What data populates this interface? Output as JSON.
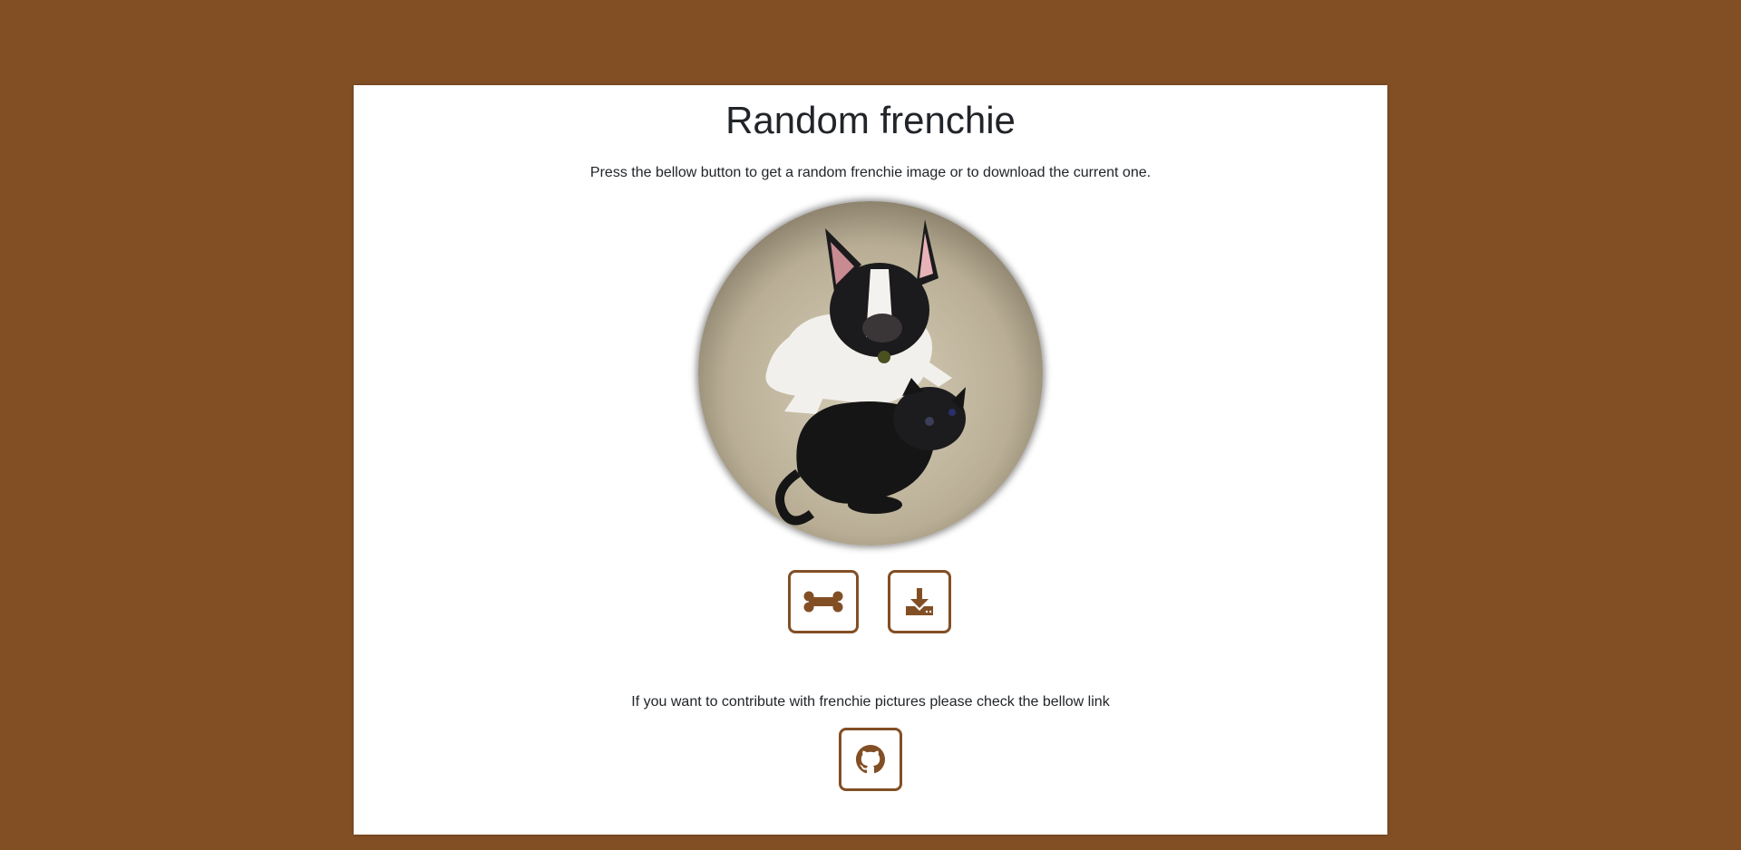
{
  "page": {
    "title": "Random frenchie",
    "subtitle": "Press the bellow button to get a random frenchie image or to download the current one.",
    "contribute_text": "If you want to contribute with frenchie pictures please check the bellow link"
  },
  "buttons": {
    "random_icon": "bone-icon",
    "download_icon": "download-icon",
    "github_icon": "github-icon"
  },
  "colors": {
    "background": "#824f25",
    "card": "#ffffff",
    "accent": "#824f25",
    "text": "#212529"
  }
}
